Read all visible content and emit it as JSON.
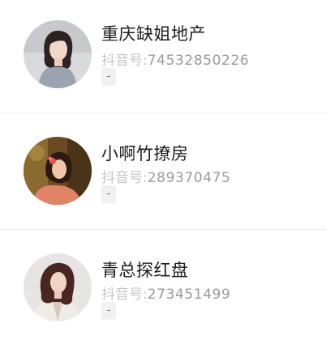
{
  "accounts": [
    {
      "name": "重庆缺姐地产",
      "douyin_label": "抖音号:",
      "douyin_id": "74532850226",
      "tag": "-"
    },
    {
      "name": "小啊竹撩房",
      "douyin_label": "抖音号:",
      "douyin_id": "289370475",
      "tag": "-"
    },
    {
      "name": "青总探红盘",
      "douyin_label": "抖音号:",
      "douyin_id": "273451499",
      "tag": "-"
    }
  ],
  "colors": {
    "name_text": "#1c1c1c",
    "id_text": "#9a9a9a",
    "label_text": "#c6c6c6",
    "divider": "#ededed",
    "tag_bg": "#f1f1f1"
  }
}
